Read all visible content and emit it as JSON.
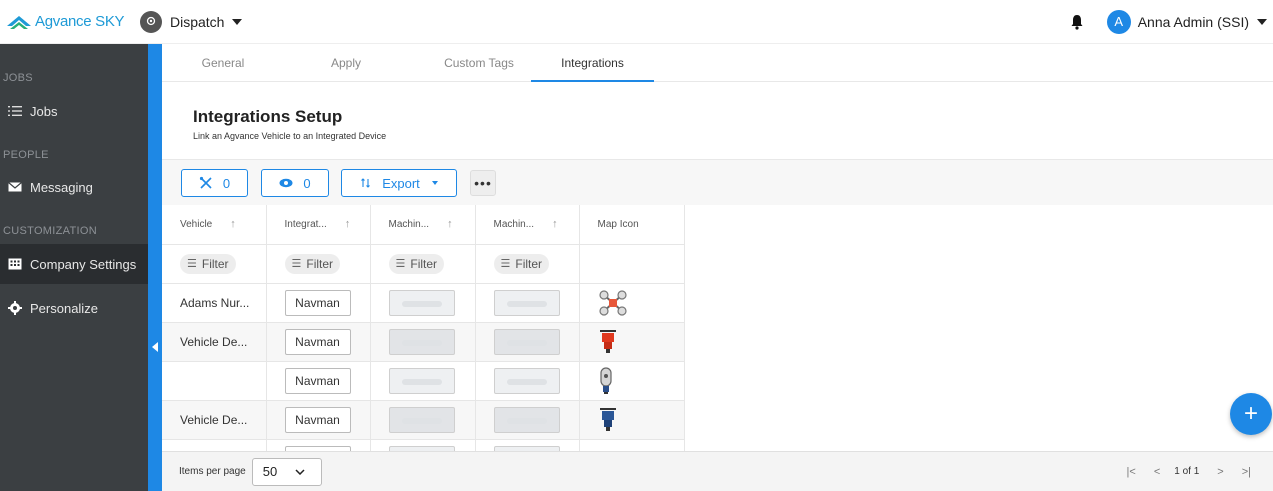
{
  "app": {
    "logo_text": "Agvance SKY",
    "module": "Dispatch",
    "user_initial": "A",
    "user_name": "Anna Admin (SSI)",
    "accent_color": "#1e88e5"
  },
  "sidebar": {
    "sections": {
      "jobs": "JOBS",
      "people": "PEOPLE",
      "customization": "CUSTOMIZATION"
    },
    "items": [
      {
        "label": "Jobs",
        "icon": "list-icon"
      },
      {
        "label": "Messaging",
        "icon": "envelope-icon"
      },
      {
        "label": "Company Settings",
        "icon": "building-icon",
        "active": true
      },
      {
        "label": "Personalize",
        "icon": "gear-icon"
      }
    ]
  },
  "tabs": [
    {
      "label": "General"
    },
    {
      "label": "Apply"
    },
    {
      "label": "Custom Tags"
    },
    {
      "label": "Integrations",
      "active": true
    }
  ],
  "setup": {
    "title": "Integrations Setup",
    "subtitle": "Link an Agvance Vehicle to an Integrated Device"
  },
  "toolbar": {
    "unassigned_count": "0",
    "visible_count": "0",
    "export_label": "Export",
    "more_label": "•••"
  },
  "grid": {
    "columns": [
      {
        "label": "Vehicle"
      },
      {
        "label": "Integrat..."
      },
      {
        "label": "Machin..."
      },
      {
        "label": "Machin..."
      },
      {
        "label": "Map Icon"
      }
    ],
    "filter_label": "Filter",
    "rows": [
      {
        "vehicle": "Adams Nur...",
        "integration": "Navman",
        "map_icon": "drone-icon"
      },
      {
        "vehicle": "Vehicle De...",
        "integration": "Navman",
        "map_icon": "red-truck-icon"
      },
      {
        "vehicle": "",
        "integration": "Navman",
        "map_icon": "gray-capsule-icon"
      },
      {
        "vehicle": "Vehicle De...",
        "integration": "Navman",
        "map_icon": "blue-truck-icon"
      }
    ]
  },
  "footer": {
    "items_per_page_label": "Items per page",
    "items_per_page_value": "50",
    "page_text": "1 of 1"
  }
}
